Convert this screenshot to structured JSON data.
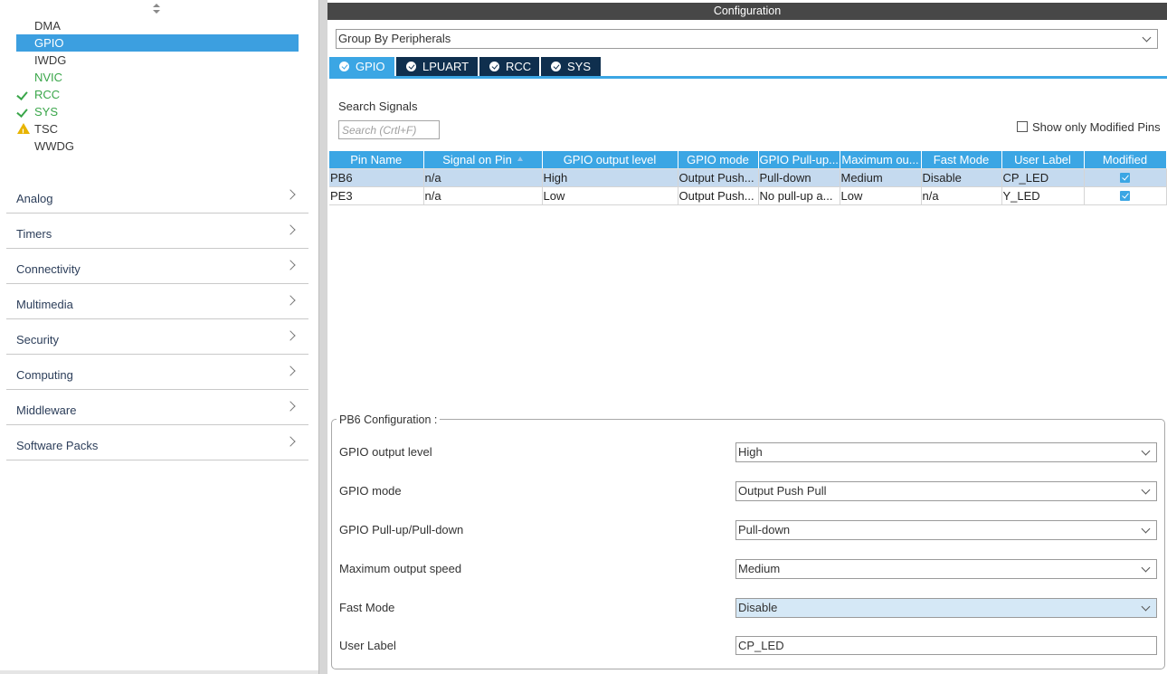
{
  "peripherals": [
    {
      "label": "DMA",
      "status": "none",
      "selected": false
    },
    {
      "label": "GPIO",
      "status": "none",
      "selected": true
    },
    {
      "label": "IWDG",
      "status": "none",
      "selected": false
    },
    {
      "label": "NVIC",
      "status": "none",
      "selected": false,
      "color": "#3aa64a"
    },
    {
      "label": "RCC",
      "status": "ok",
      "selected": false,
      "color": "#3aa64a"
    },
    {
      "label": "SYS",
      "status": "ok",
      "selected": false,
      "color": "#3aa64a"
    },
    {
      "label": "TSC",
      "status": "warning",
      "selected": false
    },
    {
      "label": "WWDG",
      "status": "none",
      "selected": false
    }
  ],
  "categories": [
    "Analog",
    "Timers",
    "Connectivity",
    "Multimedia",
    "Security",
    "Computing",
    "Middleware",
    "Software Packs"
  ],
  "config": {
    "title": "Configuration",
    "group_by": "Group By Peripherals",
    "tabs": [
      {
        "label": "GPIO",
        "active": true
      },
      {
        "label": "LPUART",
        "active": false
      },
      {
        "label": "RCC",
        "active": false
      },
      {
        "label": "SYS",
        "active": false
      }
    ],
    "search_label": "Search Signals",
    "search_placeholder": "Search (Crtl+F)",
    "show_modified_label": "Show only Modified Pins"
  },
  "table": {
    "columns": [
      "Pin Name",
      "Signal on Pin",
      "GPIO output level",
      "GPIO mode",
      "GPIO Pull-up...",
      "Maximum ou...",
      "Fast Mode",
      "User Label",
      "Modified"
    ],
    "rows": [
      {
        "pin": "PB6",
        "signal": "n/a",
        "level": "High",
        "mode": "Output Push...",
        "pull": "Pull-down",
        "speed": "Medium",
        "fast": "Disable",
        "label": "CP_LED",
        "modified": true,
        "selected": true
      },
      {
        "pin": "PE3",
        "signal": "n/a",
        "level": "Low",
        "mode": "Output Push...",
        "pull": "No pull-up a...",
        "speed": "Low",
        "fast": "n/a",
        "label": "Y_LED",
        "modified": true,
        "selected": false
      }
    ]
  },
  "pin_config": {
    "legend": "PB6 Configuration :",
    "fields": [
      {
        "label": "GPIO output level",
        "value": "High"
      },
      {
        "label": "GPIO mode",
        "value": "Output Push Pull"
      },
      {
        "label": "GPIO Pull-up/Pull-down",
        "value": "Pull-down"
      },
      {
        "label": "Maximum output speed",
        "value": "Medium"
      },
      {
        "label": "Fast Mode",
        "value": "Disable"
      },
      {
        "label": "User Label",
        "value": "CP_LED"
      }
    ]
  },
  "colors": {
    "accent": "#3ba6e4",
    "tab_inactive": "#0f2f4e",
    "selected_row": "#c5daef",
    "ok_green": "#3aa64a",
    "warning": "#e8b400"
  }
}
